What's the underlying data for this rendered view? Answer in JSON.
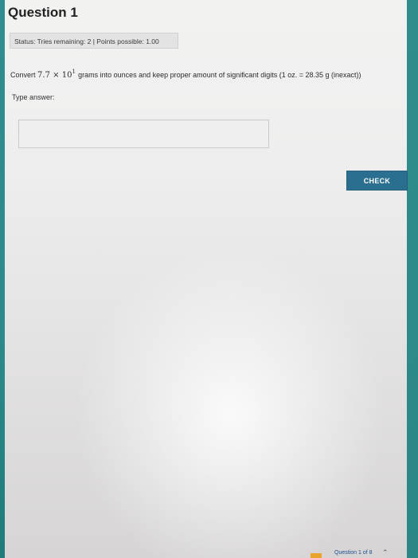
{
  "question": {
    "title": "Question 1",
    "status": "Status: Tries remaining: 2 | Points possible: 1.00",
    "prompt_prefix": "Convert",
    "prompt_coefficient": "7.7",
    "prompt_times": "×",
    "prompt_base": "10",
    "prompt_exponent": "1",
    "prompt_suffix": "grams into ounces and keep proper amount of significant digits (1 oz. = 28.35 g (inexact))"
  },
  "answer": {
    "label": "Type answer:",
    "value": ""
  },
  "actions": {
    "check_label": "CHECK"
  },
  "footer": {
    "nav_text": "Question 1 of 8"
  },
  "colors": {
    "accent_button": "#2a6f8f",
    "edge_teal": "#2a8b8a",
    "footer_accent": "#e8a32a"
  }
}
